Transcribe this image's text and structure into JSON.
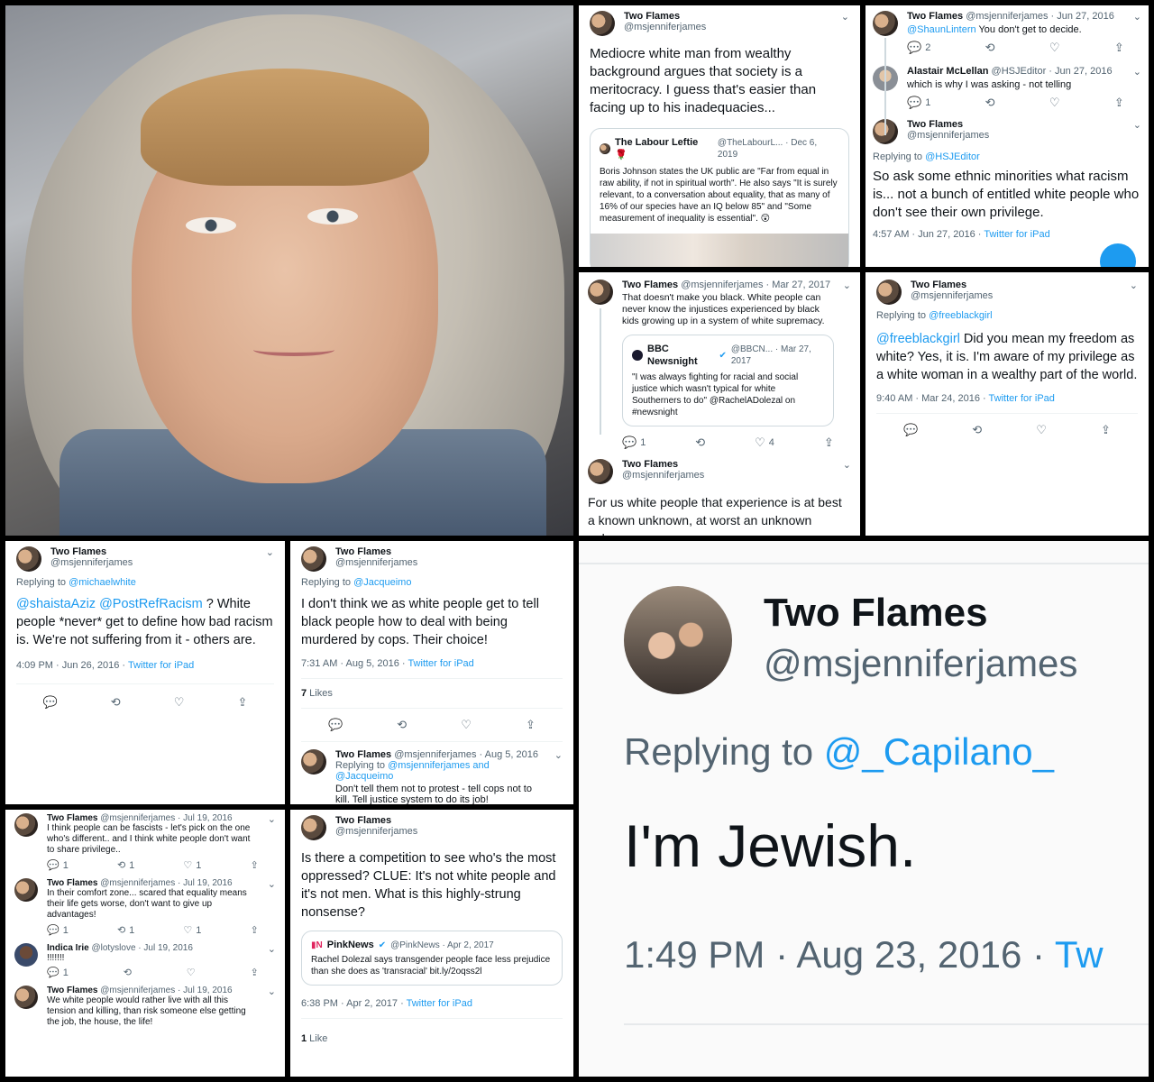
{
  "photo_panel": {
    "description_icon": "hooded-woman-photo"
  },
  "p2": {
    "name": "Two Flames",
    "handle": "@msjenniferjames",
    "text": "Mediocre white man from wealthy background argues that society is a meritocracy. I guess that's easier than facing up to his inadequacies...",
    "quote": {
      "name": "The Labour Leftie 🌹",
      "meta": "@TheLabourL... · Dec 6, 2019",
      "text": "Boris Johnson states the UK public are \"Far from equal in raw ability, if not in spiritual worth\". He also says \"It is surely relevant, to a conversation about equality, that as many of 16% of our species have an IQ below 85\" and \"Some measurement of inequality is essential\". 😲"
    }
  },
  "p3": {
    "t1": {
      "name": "Two Flames",
      "meta": "@msjenniferjames · Jun 27, 2016",
      "mention": "@ShaunLintern",
      "text": " You don't get to decide.",
      "replies": "2"
    },
    "t2": {
      "name": "Alastair McLellan",
      "meta": "@HSJEditor · Jun 27, 2016",
      "text": "which is why I was asking - not telling",
      "replies": "1"
    },
    "t3": {
      "name": "Two Flames",
      "handle": "@msjenniferjames",
      "replying": "Replying to ",
      "replying_to": "@HSJEditor",
      "text": "So ask some ethnic minorities what racism is... not a bunch of entitled white people who don't see their own privilege.",
      "time": "4:57 AM · Jun 27, 2016 · ",
      "source": "Twitter for iPad"
    }
  },
  "p4": {
    "t1": {
      "name": "Two Flames",
      "meta": "@msjenniferjames · Mar 27, 2017",
      "text": "That doesn't make you black. White people can never know the injustices experienced by black kids growing up in a system of white supremacy."
    },
    "quote": {
      "name": "BBC Newsnight",
      "meta": "@BBCN... · Mar 27, 2017",
      "text": "\"I was always fighting for racial and social justice which wasn't typical for white Southerners to do\" @RachelADolezal on #newsnight"
    },
    "replies": "1",
    "likes": "4",
    "t2": {
      "name": "Two Flames",
      "handle": "@msjenniferjames",
      "text": "For us white people that experience is at best a known unknown, at worst an unknown unknown."
    }
  },
  "p5": {
    "name": "Two Flames",
    "handle": "@msjenniferjames",
    "replying": "Replying to ",
    "replying_to": "@freeblackgirl",
    "mention": "@freeblackgirl",
    "text": " Did you mean my freedom as white? Yes, it is. I'm aware of my privilege as a white woman in a wealthy part of the world.",
    "time": "9:40 AM · Mar 24, 2016 · ",
    "source": "Twitter for iPad"
  },
  "p6": {
    "name": "Two Flames",
    "handle": "@msjenniferjames",
    "replying": "Replying to ",
    "replying_to": "@michaelwhite",
    "mention": "@shaistaAziz @PostRefRacism",
    "text": " ? White people *never* get to define how bad racism is. We're not suffering from it - others are.",
    "time": "4:09 PM · Jun 26, 2016 · ",
    "source": "Twitter for iPad"
  },
  "p7": {
    "name": "Two Flames",
    "handle": "@msjenniferjames",
    "replying": "Replying to ",
    "replying_to": "@Jacqueimo",
    "text": "I don't think we as white people get to tell black people how to deal with being murdered by cops. Their choice!",
    "time": "7:31 AM · Aug 5, 2016 · ",
    "source": "Twitter for iPad",
    "likes_count": "7",
    "likes_label": " Likes",
    "r": {
      "name": "Two Flames",
      "meta": "@msjenniferjames · Aug 5, 2016",
      "replying": "Replying to ",
      "replying_to": "@msjenniferjames and @Jacqueimo",
      "text": "Don't tell them not to protest - tell cops not to kill. Tell justice system to do its job!"
    }
  },
  "p8": {
    "header": {
      "name": "Two Flames",
      "handle": "@msjenniferjames",
      "replying": "Replying to ",
      "replying_to": "@_Capilano_"
    },
    "text": "I'm Jewish.",
    "time": "1:49 PM · Aug 23, 2016 · ",
    "source": "Tw"
  },
  "p9": {
    "t1": {
      "name": "Two Flames",
      "meta": "@msjenniferjames · Jul 19, 2016",
      "text": "I think people can be fascists - let's pick on the one who's different.. and I think white people don't want to share privilege..",
      "replies": "1",
      "rts": "1",
      "likes": "1"
    },
    "t2": {
      "name": "Two Flames",
      "meta": "@msjenniferjames · Jul 19, 2016",
      "text": "In their comfort zone... scared that equality means their life gets worse, don't want to give up advantages!",
      "replies": "1",
      "rts": "1",
      "likes": "1"
    },
    "t3": {
      "name": "Indica Irie",
      "meta": "@lotyslove · Jul 19, 2016",
      "text": "!!!!!!!",
      "replies": "1"
    },
    "t4": {
      "name": "Two Flames",
      "meta": "@msjenniferjames · Jul 19, 2016",
      "text": "We white people would rather live with all this tension and killing, than risk someone else getting the job, the house, the life!"
    }
  },
  "p10": {
    "name": "Two Flames",
    "handle": "@msjenniferjames",
    "text": "Is there a competition to see who's the most oppressed? CLUE: It's not white people and it's not men. What is this highly-strung nonsense?",
    "quote": {
      "name": "PinkNews",
      "meta": "@PinkNews · Apr 2, 2017",
      "text": "Rachel Dolezal says transgender people face less prejudice than she does as 'transracial' bit.ly/2oqss2l"
    },
    "time": "6:38 PM · Apr 2, 2017 · ",
    "source": "Twitter for iPad",
    "likes_count": "1",
    "likes_label": " Like"
  },
  "icons": {
    "reply": "reply-icon",
    "retweet": "retweet-icon",
    "like": "like-icon",
    "share": "share-icon",
    "chevron": "chevron-down-icon"
  },
  "colors": {
    "link": "#1d9bf0",
    "text": "#0f1419",
    "muted": "#536471"
  }
}
